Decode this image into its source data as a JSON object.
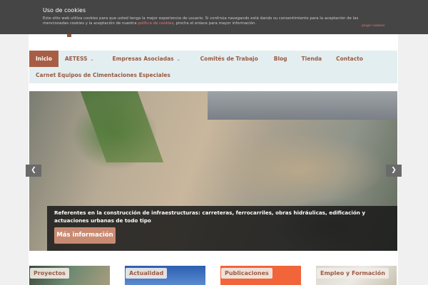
{
  "cookie": {
    "title": "Uso de cookies",
    "text_before": "Este sitio web utiliza cookies para que usted tenga la mejor experiencia de usuario. Si continúa navegando está dando su consentimiento para la aceptación de las mencionadas cookies y la aceptación de nuestra ",
    "link": "política de cookies",
    "text_after": ", pinche el enlace para mayor información.",
    "plugin": "plugin cookies"
  },
  "nav": {
    "items": [
      {
        "label": "Inicio"
      },
      {
        "label": "AETESS"
      },
      {
        "label": "Empresas Asociadas"
      },
      {
        "label": "Comités de Trabajo"
      },
      {
        "label": "Blog"
      },
      {
        "label": "Tienda"
      },
      {
        "label": "Contacto"
      },
      {
        "label": "Carnet Equipos de Cimentaciones Especiales"
      }
    ],
    "chevron": "⌄"
  },
  "slider": {
    "caption": "Referentes en la construcción de infraestructuras: carreteras, ferrocarriles, obras hidráulicas, edificación y actuaciones urbanas de todo tipo",
    "button": "Más información",
    "prev": "❮",
    "next": "❯"
  },
  "tiles": [
    {
      "label": "Proyectos"
    },
    {
      "label": "Actualidad"
    },
    {
      "label": "Publicaciones"
    },
    {
      "label": "Empleo y Formación"
    }
  ]
}
